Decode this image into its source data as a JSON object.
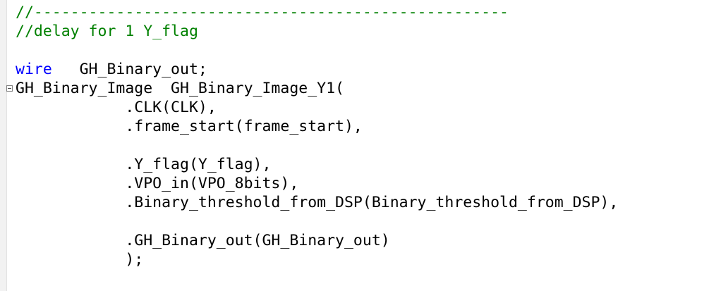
{
  "editor": {
    "lines": [
      {
        "text": "//----------------------------------------------------",
        "kind": "comment"
      },
      {
        "text": "//delay for 1 Y_flag",
        "kind": "comment"
      },
      {
        "text": "",
        "kind": "blank"
      },
      {
        "keyword": "wire",
        "rest": "   GH_Binary_out;",
        "kind": "declaration"
      },
      {
        "text": "GH_Binary_Image  GH_Binary_Image_Y1(",
        "kind": "code"
      },
      {
        "text": "            .CLK(CLK),",
        "kind": "code"
      },
      {
        "text": "            .frame_start(frame_start),",
        "kind": "code"
      },
      {
        "text": "",
        "kind": "blank"
      },
      {
        "text": "            .Y_flag(Y_flag),",
        "kind": "code"
      },
      {
        "text": "            .VPO_in(VPO_8bits),",
        "kind": "code"
      },
      {
        "text": "            .Binary_threshold_from_DSP(Binary_threshold_from_DSP),",
        "kind": "code"
      },
      {
        "text": "",
        "kind": "blank"
      },
      {
        "text": "            .GH_Binary_out(GH_Binary_out)",
        "kind": "code"
      },
      {
        "text": "            );",
        "kind": "code"
      }
    ],
    "partial_line_text": "   ,  ,    ,    ,                ,    ,    ,"
  },
  "colors": {
    "comment": "#008000",
    "keyword": "#0000ff",
    "identifier": "#000000",
    "background": "#ffffff"
  },
  "icons": {
    "fold": "collapse-fold-icon"
  }
}
